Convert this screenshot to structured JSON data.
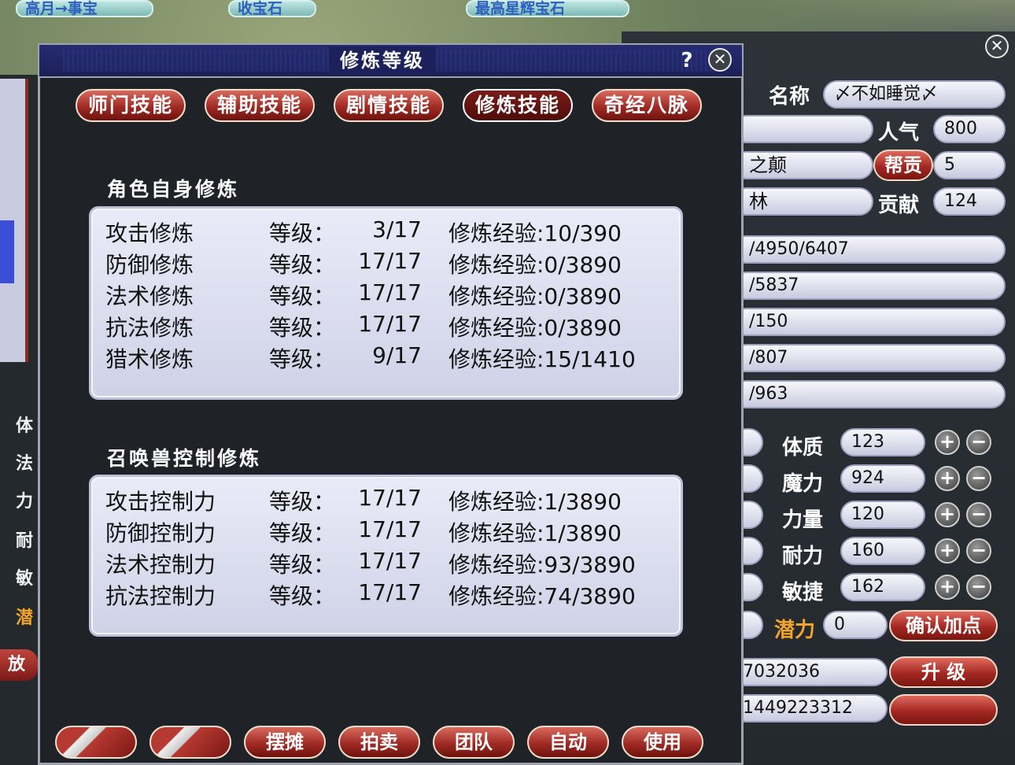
{
  "background": {
    "top_gems": [
      "高月→事宝",
      "收宝石",
      "最高星辉宝石"
    ]
  },
  "left_strip": {
    "labels": [
      "体",
      "法",
      "力",
      "耐",
      "敏",
      "潜"
    ],
    "button": "放"
  },
  "dialog": {
    "title": "修炼等级",
    "help": "?",
    "close": "✕",
    "tabs": [
      "师门技能",
      "辅助技能",
      "剧情技能",
      "修炼技能",
      "奇经八脉"
    ],
    "active_tab_index": 3,
    "role_section": {
      "title": "角色自身修炼",
      "level_label": "等级：",
      "rows": [
        {
          "name": "攻击修炼",
          "level": "3/17",
          "exp": "修炼经验:10/390"
        },
        {
          "name": "防御修炼",
          "level": "17/17",
          "exp": "修炼经验:0/3890"
        },
        {
          "name": "法术修炼",
          "level": "17/17",
          "exp": "修炼经验:0/3890"
        },
        {
          "name": "抗法修炼",
          "level": "17/17",
          "exp": "修炼经验:0/3890"
        },
        {
          "name": "猎术修炼",
          "level": "9/17",
          "exp": "修炼经验:15/1410"
        }
      ]
    },
    "pet_section": {
      "title": "召唤兽控制修炼",
      "level_label": "等级：",
      "rows": [
        {
          "name": "攻击控制力",
          "level": "17/17",
          "exp": "修炼经验:1/3890"
        },
        {
          "name": "防御控制力",
          "level": "17/17",
          "exp": "修炼经验:1/3890"
        },
        {
          "name": "法术控制力",
          "level": "17/17",
          "exp": "修炼经验:93/3890"
        },
        {
          "name": "抗法控制力",
          "level": "17/17",
          "exp": "修炼经验:74/3890"
        }
      ]
    },
    "bottom_buttons": [
      "摆摊",
      "拍卖",
      "团队",
      "自动",
      "使用"
    ]
  },
  "attr_panel": {
    "name_label": "名称",
    "name_value": "〆不如睡觉〆",
    "popularity_label": "人气",
    "popularity_value": "800",
    "partial_field_1": "之颠",
    "gang_contrib_button": "帮贡",
    "gang_contrib_value": "5",
    "partial_field_2": "林",
    "contribution_label": "贡献",
    "contribution_value": "124",
    "bars": [
      "/4950/6407",
      "/5837",
      "/150",
      "/807",
      "/963"
    ],
    "attributes": [
      {
        "label": "体质",
        "value": "123"
      },
      {
        "label": "魔力",
        "value": "924"
      },
      {
        "label": "力量",
        "value": "120"
      },
      {
        "label": "耐力",
        "value": "160"
      },
      {
        "label": "敏捷",
        "value": "162"
      }
    ],
    "plus": "+",
    "minus": "−",
    "potential_label": "潜力",
    "potential_value": "0",
    "confirm_button": "确认加点",
    "exp_value": "7032036",
    "levelup_button": "升 级",
    "money_value": "1449223312",
    "close": "✕"
  }
}
